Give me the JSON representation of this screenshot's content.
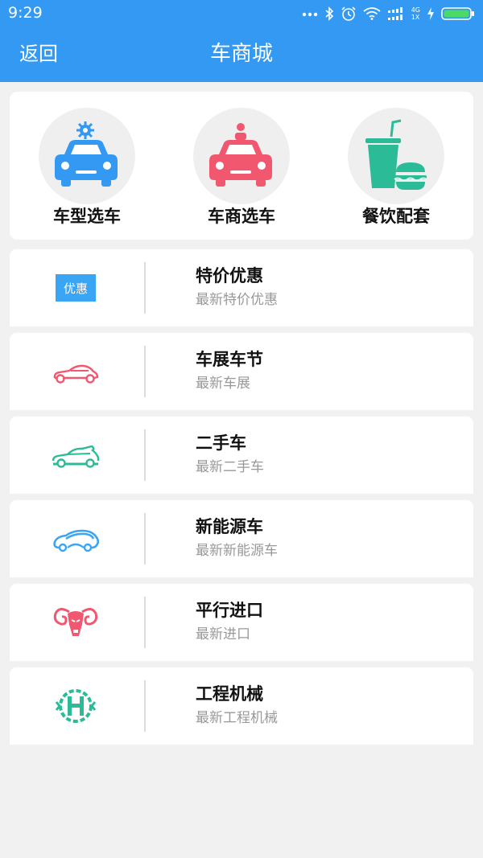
{
  "status_bar": {
    "time": "9:29",
    "network_top": "4G",
    "network_bottom": "1X"
  },
  "nav": {
    "back_label": "返回",
    "title": "车商城"
  },
  "categories": [
    {
      "label": "车型选车",
      "icon": "blue-car-gear-icon",
      "color": "#3399f3"
    },
    {
      "label": "车商选车",
      "icon": "pink-car-person-icon",
      "color": "#f1586f"
    },
    {
      "label": "餐饮配套",
      "icon": "drink-burger-icon",
      "color": "#2bbb96"
    }
  ],
  "list": [
    {
      "title": "特价优惠",
      "subtitle": "最新特价优惠",
      "icon": "coupon-icon",
      "icon_text": "优惠"
    },
    {
      "title": "车展车节",
      "subtitle": "最新车展",
      "icon": "sports-car-icon"
    },
    {
      "title": "二手车",
      "subtitle": "最新二手车",
      "icon": "used-car-icon"
    },
    {
      "title": "新能源车",
      "subtitle": "最新新能源车",
      "icon": "eco-car-icon"
    },
    {
      "title": "平行进口",
      "subtitle": "最新进口",
      "icon": "ram-logo-icon"
    },
    {
      "title": "工程机械",
      "subtitle": "最新工程机械",
      "icon": "machinery-gear-icon"
    }
  ]
}
